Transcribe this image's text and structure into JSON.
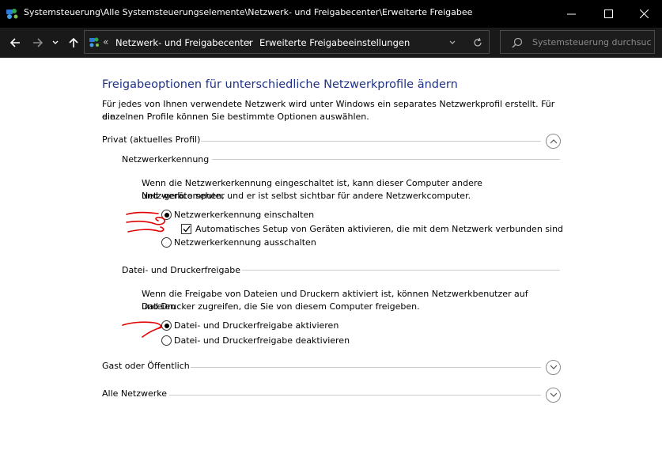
{
  "window": {
    "title": "Systemsteuerung\\Alle Systemsteuerungselemente\\Netzwerk- und Freigabecenter\\Erweiterte Freigabee"
  },
  "navbar": {
    "crumb_more": "«",
    "crumbs": [
      "Netzwerk- und Freigabecenter",
      "Erweiterte Freigabeeinstellungen"
    ],
    "separator": "›",
    "search_placeholder": "Systemsteuerung durchsuc..."
  },
  "page": {
    "heading": "Freigabeoptionen für unterschiedliche Netzwerkprofile ändern",
    "intro_line1": "Für jedes von Ihnen verwendete Netzwerk wird unter Windows ein separates Netzwerkprofil erstellt. Für die",
    "intro_line2": "einzelnen Profile können Sie bestimmte Optionen auswählen."
  },
  "profiles": {
    "private": {
      "label": "Privat (aktuelles Profil)",
      "expanded": true,
      "network_discovery": {
        "label": "Netzwerkerkennung",
        "desc_line1": "Wenn die Netzwerkerkennung eingeschaltet ist, kann dieser Computer andere Netzwerkcomputer",
        "desc_line2": "und -geräte sehen, und er ist selbst sichtbar für andere Netzwerkcomputer.",
        "on_label": "Netzwerkerkennung einschalten",
        "auto_setup_label": "Automatisches Setup von Geräten aktivieren, die mit dem Netzwerk verbunden sind",
        "off_label": "Netzwerkerkennung ausschalten",
        "selected": "on",
        "auto_setup_checked": true
      },
      "file_printer_sharing": {
        "label": "Datei- und Druckerfreigabe",
        "desc_line1": "Wenn die Freigabe von Dateien und Druckern aktiviert ist, können Netzwerkbenutzer auf Dateien",
        "desc_line2": "und Drucker zugreifen, die Sie von diesem Computer freigeben.",
        "on_label": "Datei- und Druckerfreigabe aktivieren",
        "off_label": "Datei- und Druckerfreigabe deaktivieren",
        "selected": "on"
      }
    },
    "guest": {
      "label": "Gast oder Öffentlich",
      "expanded": false
    },
    "all": {
      "label": "Alle Netzwerke",
      "expanded": false
    }
  },
  "colors": {
    "heading": "#1e3287",
    "annotation": "#e00000",
    "titlebar": "#000000",
    "navbar": "#191919"
  }
}
